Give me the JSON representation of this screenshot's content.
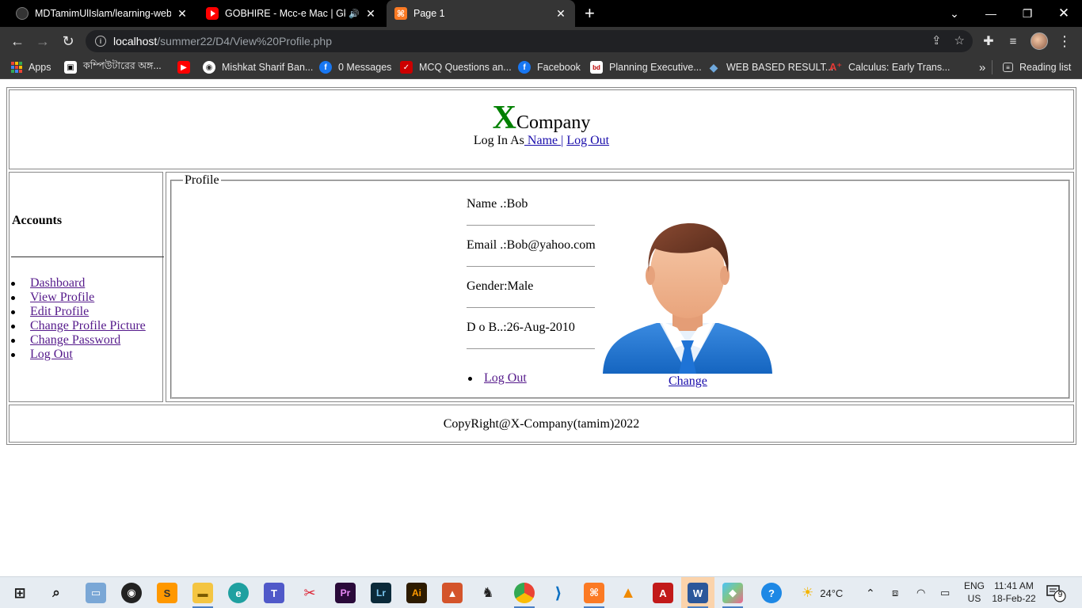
{
  "browser": {
    "tabs": [
      {
        "title": "MDTamimUlIslam/learning-web-",
        "active": false
      },
      {
        "title": "GOBHIRE - Mcc-e Mac | Gk K",
        "active": false
      },
      {
        "title": "Page 1",
        "active": true
      }
    ],
    "url_host": "localhost",
    "url_path": "/summer22/D4/View%20Profile.php",
    "bookmarks": [
      "Apps",
      "কম্পিউটারের অঙ্গ...",
      "Mishkat Sharif Ban...",
      "0 Messages",
      "MCQ Questions an...",
      "Facebook",
      "Planning Executive...",
      "WEB BASED RESULT...",
      "Calculus: Early Trans..."
    ],
    "more_bookmarks": "»",
    "reading_list": "Reading list"
  },
  "page": {
    "logo_letter": "X",
    "logo_rest": "Company",
    "login_prefix": "Log In As",
    "login_name": " Name ",
    "login_sep": "|",
    "login_logout": " Log Out",
    "sidebar_heading": "Accounts",
    "menu": [
      "Dashboard",
      "View Profile",
      "Edit Profile",
      "Change Profile Picture",
      "Change Password",
      "Log Out"
    ],
    "legend": "Profile",
    "profile_rows": [
      "Name .:Bob",
      "Email .:Bob@yahoo.com",
      "Gender:Male",
      "D o B..:26-Aug-2010"
    ],
    "profile_logout": "Log Out",
    "change_link": "Change",
    "footer": "CopyRight@X-Company(tamim)2022"
  },
  "taskbar": {
    "weather": "24°C",
    "lang_line1": "ENG",
    "lang_line2": "US",
    "time": "11:41 AM",
    "date": "18-Feb-22",
    "notification_count": "9"
  }
}
